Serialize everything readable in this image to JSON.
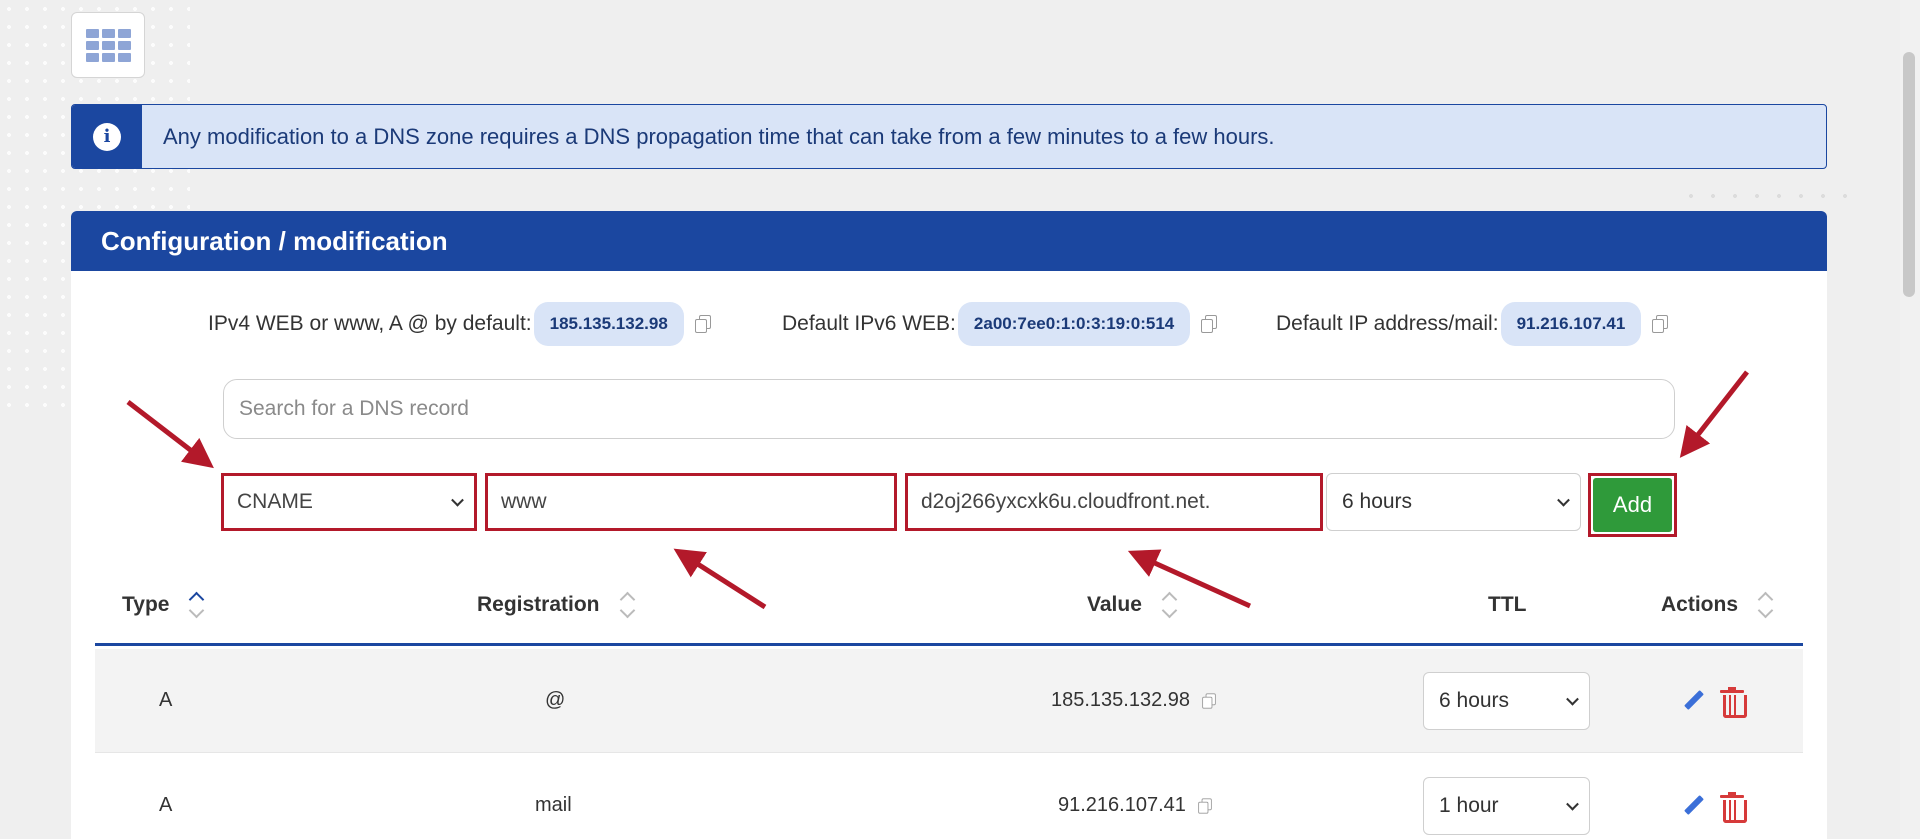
{
  "alert": {
    "text": "Any modification to a DNS zone requires a DNS propagation time that can take from a few minutes to a few hours."
  },
  "panel": {
    "title": "Configuration / modification",
    "defaults": [
      {
        "label": "IPv4 WEB or www, A @ by default:",
        "value": "185.135.132.98"
      },
      {
        "label": "Default IPv6 WEB:",
        "value": "2a00:7ee0:1:0:3:19:0:514"
      },
      {
        "label": "Default IP address/mail:",
        "value": "91.216.107.41"
      }
    ],
    "search_placeholder": "Search for a DNS record",
    "form": {
      "type": "CNAME",
      "name": "www",
      "value": "d2oj266yxcxk6u.cloudfront.net.",
      "ttl": "6 hours",
      "add_label": "Add"
    }
  },
  "table": {
    "headers": {
      "type": "Type",
      "registration": "Registration",
      "value": "Value",
      "ttl": "TTL",
      "actions": "Actions"
    },
    "rows": [
      {
        "type": "A",
        "registration": "@",
        "value": "185.135.132.98",
        "ttl": "6 hours"
      },
      {
        "type": "A",
        "registration": "mail",
        "value": "91.216.107.41",
        "ttl": "1 hour"
      }
    ]
  },
  "colors": {
    "brand": "#1b47a0",
    "alert_bg": "#d9e4f7",
    "add_green": "#2f9a3a",
    "highlight_red": "#b3192a",
    "delete_red": "#d63a3a"
  },
  "icons": [
    "apps-grid-icon",
    "info-icon",
    "copy-icon",
    "chevron-down-icon",
    "sort-icon",
    "edit-icon",
    "trash-icon"
  ]
}
